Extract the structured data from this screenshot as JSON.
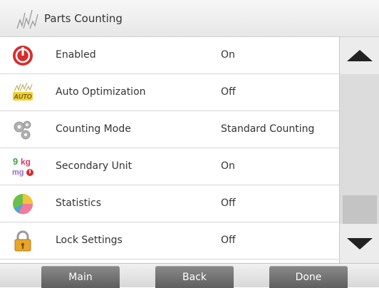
{
  "header": {
    "title": "Parts Counting",
    "icon": "parts-counting-icon"
  },
  "rows": [
    {
      "label": "Enabled",
      "value": "On",
      "icon": "enabled-power-icon"
    },
    {
      "label": "Auto Optimization",
      "value": "Off",
      "icon": "auto-optimization-icon"
    },
    {
      "label": "Counting Mode",
      "value": "Standard Counting",
      "icon": "gears-icon"
    },
    {
      "label": "Secondary Unit",
      "value": "On",
      "icon": "secondary-unit-icon"
    },
    {
      "label": "Statistics",
      "value": "Off",
      "icon": "statistics-pie-icon"
    },
    {
      "label": "Lock Settings",
      "value": "Off",
      "icon": "lock-icon"
    }
  ],
  "icon_text": {
    "auto": "AUTO",
    "kg": "kg",
    "g": "9",
    "mg": "mg"
  },
  "footer": {
    "main_label": "Main",
    "back_label": "Back",
    "done_label": "Done"
  },
  "colors": {
    "header_bg": "#eeeeee",
    "row_divider": "#d6d6d6",
    "scrollbar_bg": "#dcdcdc",
    "button_bg": "#6f6f6f",
    "button_text": "#ffffff"
  }
}
